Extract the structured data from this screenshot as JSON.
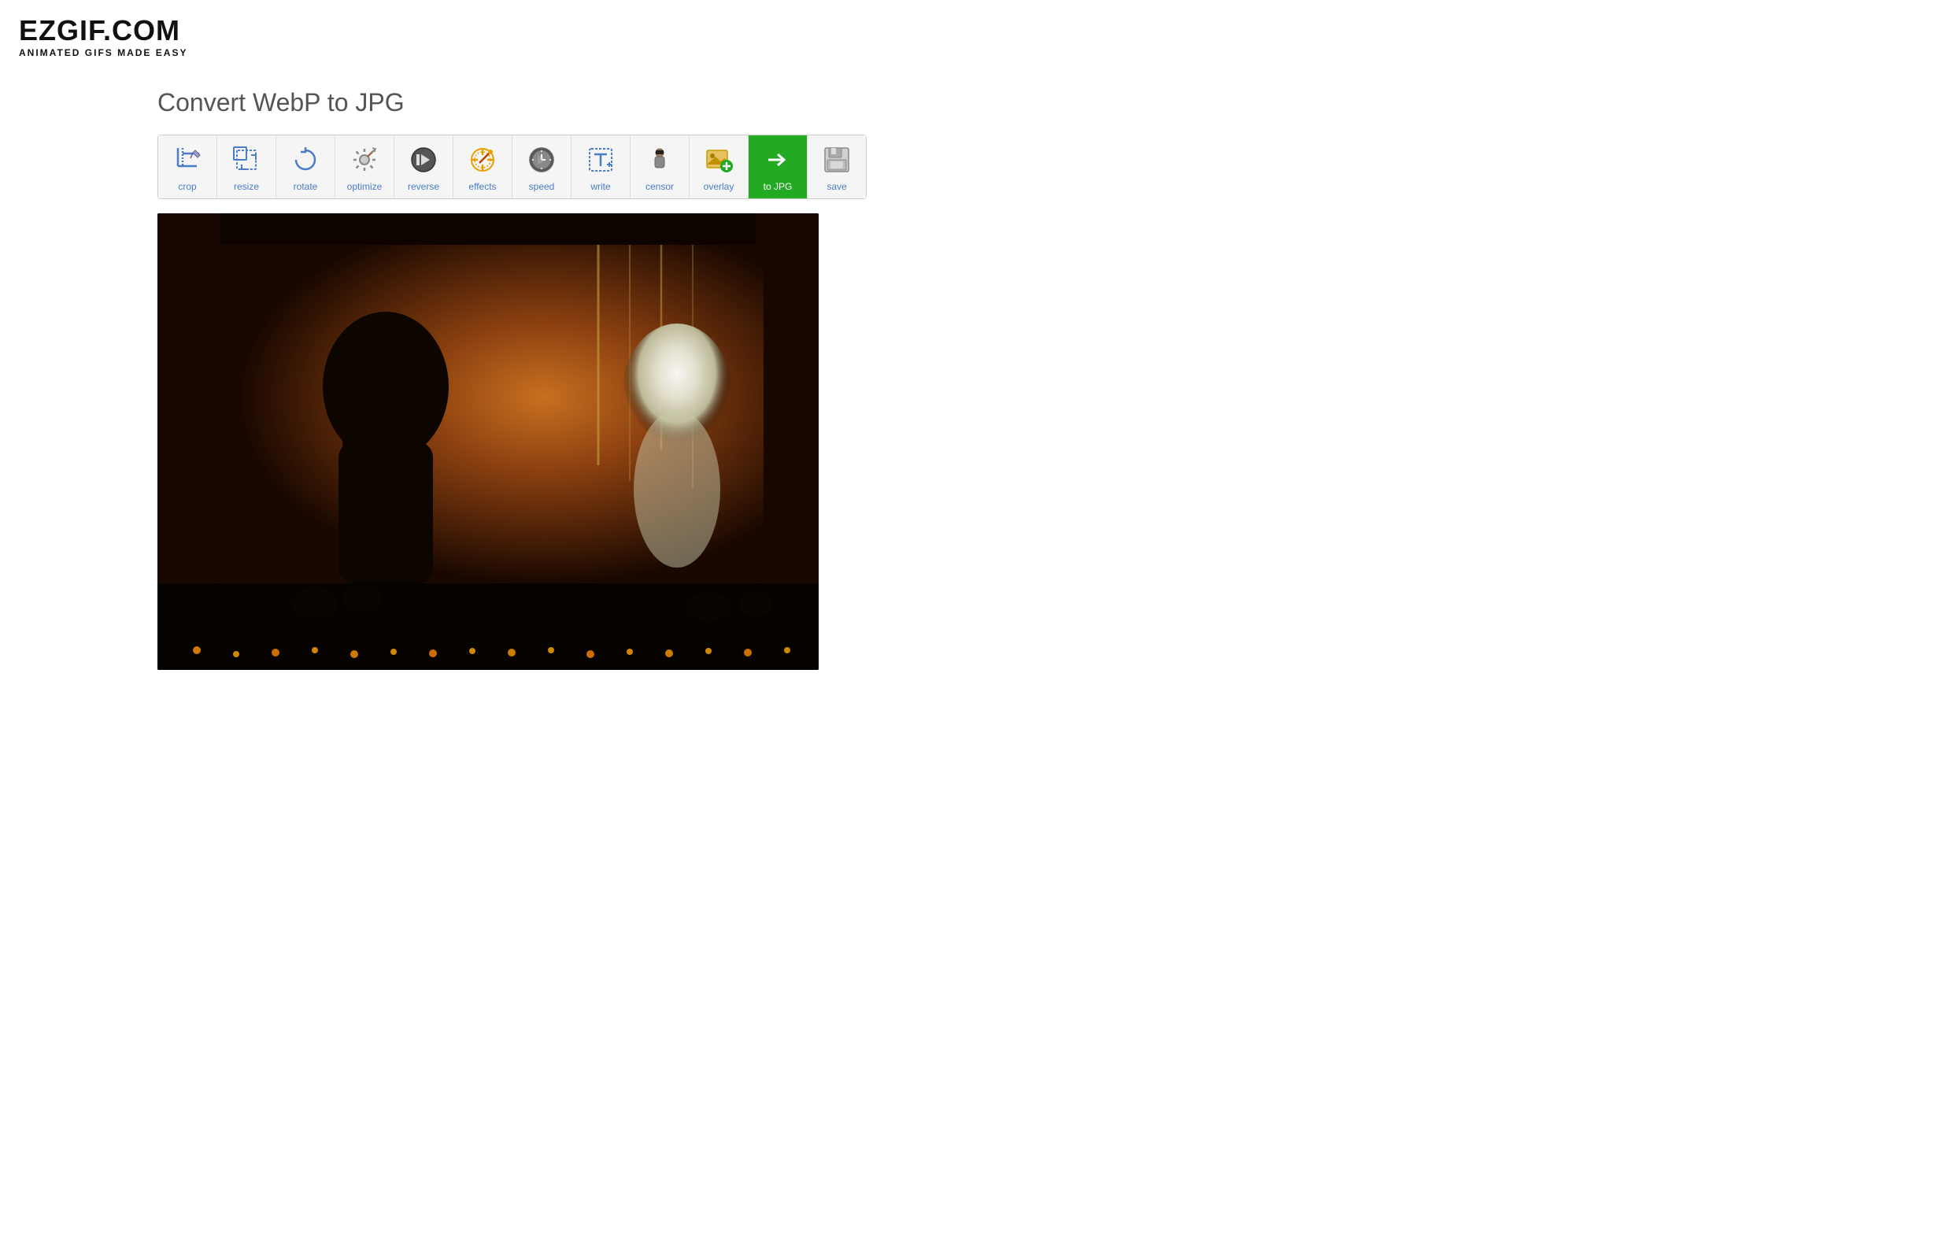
{
  "logo": {
    "title": "EZGIF.COM",
    "subtitle": "ANIMATED GIFS MADE EASY"
  },
  "page": {
    "title": "Convert WebP to JPG"
  },
  "toolbar": {
    "tools": [
      {
        "id": "crop",
        "label": "crop",
        "active": false
      },
      {
        "id": "resize",
        "label": "resize",
        "active": false
      },
      {
        "id": "rotate",
        "label": "rotate",
        "active": false
      },
      {
        "id": "optimize",
        "label": "optimize",
        "active": false
      },
      {
        "id": "reverse",
        "label": "reverse",
        "active": false
      },
      {
        "id": "effects",
        "label": "effects",
        "active": false
      },
      {
        "id": "speed",
        "label": "speed",
        "active": false
      },
      {
        "id": "write",
        "label": "write",
        "active": false
      },
      {
        "id": "censor",
        "label": "censor",
        "active": false
      },
      {
        "id": "overlay",
        "label": "overlay",
        "active": false
      },
      {
        "id": "to-jpg",
        "label": "to JPG",
        "active": true
      },
      {
        "id": "save",
        "label": "save",
        "active": false
      }
    ]
  }
}
